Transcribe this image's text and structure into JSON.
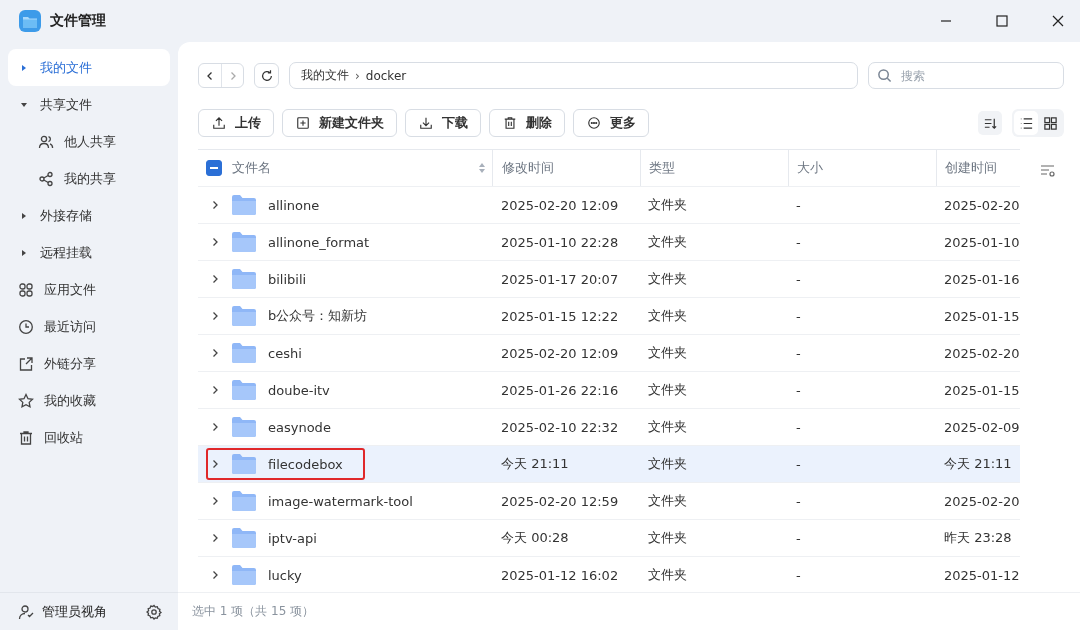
{
  "window": {
    "title": "文件管理"
  },
  "sidebar": {
    "items": [
      {
        "label": "我的文件",
        "kind": "tree",
        "expanded": false,
        "selected": true
      },
      {
        "label": "共享文件",
        "kind": "tree",
        "expanded": true,
        "selected": false,
        "children": [
          {
            "label": "他人共享",
            "selected": false
          },
          {
            "label": "我的共享",
            "selected": false
          }
        ]
      },
      {
        "label": "外接存储",
        "kind": "tree",
        "expanded": false,
        "selected": false
      },
      {
        "label": "远程挂载",
        "kind": "tree",
        "expanded": false,
        "selected": false
      },
      {
        "label": "应用文件",
        "kind": "link",
        "selected": false
      },
      {
        "label": "最近访问",
        "kind": "link",
        "selected": false
      },
      {
        "label": "外链分享",
        "kind": "link",
        "selected": false
      },
      {
        "label": "我的收藏",
        "kind": "link",
        "selected": false
      },
      {
        "label": "回收站",
        "kind": "link",
        "selected": false
      }
    ],
    "footer": {
      "label": "管理员视角"
    }
  },
  "breadcrumb": [
    "我的文件",
    "docker"
  ],
  "breadcrumb_separator": "›",
  "search": {
    "placeholder": "搜索"
  },
  "toolbar": [
    "上传",
    "新建文件夹",
    "下载",
    "删除",
    "更多"
  ],
  "view_buttons": [
    {
      "selected": true
    },
    {
      "selected": false
    }
  ],
  "table": {
    "select_all": {
      "indeterminate": true
    },
    "columns": [
      "文件名",
      "修改时间",
      "类型",
      "大小",
      "创建时间"
    ],
    "rows": [
      {
        "name": "allinone",
        "modified": "2025-02-20 12:09",
        "type": "文件夹",
        "size": "-",
        "created": "2025-02-20",
        "selected": false,
        "annotated": false
      },
      {
        "name": "allinone_format",
        "modified": "2025-01-10 22:28",
        "type": "文件夹",
        "size": "-",
        "created": "2025-01-10",
        "selected": false,
        "annotated": false
      },
      {
        "name": "bilibili",
        "modified": "2025-01-17 20:07",
        "type": "文件夹",
        "size": "-",
        "created": "2025-01-16",
        "selected": false,
        "annotated": false
      },
      {
        "name": "b公众号：知新坊",
        "modified": "2025-01-15 12:22",
        "type": "文件夹",
        "size": "-",
        "created": "2025-01-15",
        "selected": false,
        "annotated": false
      },
      {
        "name": "ceshi",
        "modified": "2025-02-20 12:09",
        "type": "文件夹",
        "size": "-",
        "created": "2025-02-20",
        "selected": false,
        "annotated": false
      },
      {
        "name": "doube-itv",
        "modified": "2025-01-26 22:16",
        "type": "文件夹",
        "size": "-",
        "created": "2025-01-15",
        "selected": false,
        "annotated": false
      },
      {
        "name": "easynode",
        "modified": "2025-02-10 22:32",
        "type": "文件夹",
        "size": "-",
        "created": "2025-02-09",
        "selected": false,
        "annotated": false
      },
      {
        "name": "filecodebox",
        "modified": "今天 21:11",
        "type": "文件夹",
        "size": "-",
        "created": "今天 21:11",
        "selected": true,
        "annotated": true
      },
      {
        "name": "image-watermark-tool",
        "modified": "2025-02-20 12:59",
        "type": "文件夹",
        "size": "-",
        "created": "2025-02-20",
        "selected": false,
        "annotated": false
      },
      {
        "name": "iptv-api",
        "modified": "今天 00:28",
        "type": "文件夹",
        "size": "-",
        "created": "昨天 23:28",
        "selected": false,
        "annotated": false
      },
      {
        "name": "lucky",
        "modified": "2025-01-12 16:02",
        "type": "文件夹",
        "size": "-",
        "created": "2025-01-12",
        "selected": false,
        "annotated": false
      }
    ]
  },
  "status_bar": "选中 1 项（共 15 项）"
}
